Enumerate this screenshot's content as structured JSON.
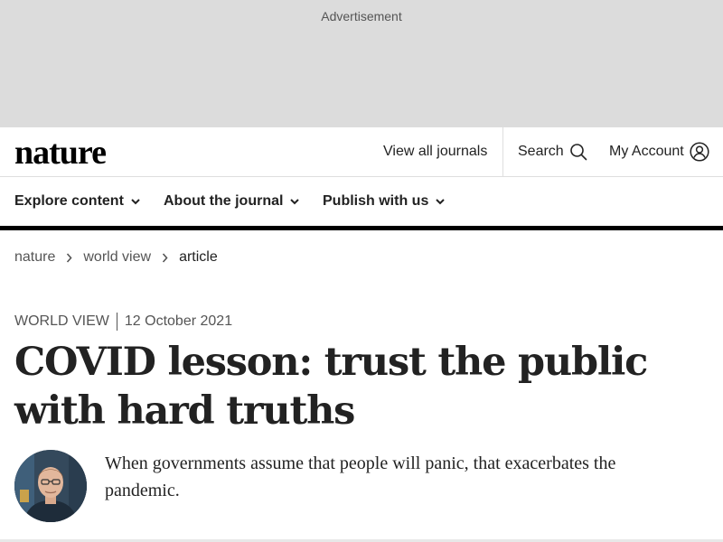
{
  "advertisement": {
    "label": "Advertisement"
  },
  "header": {
    "logo": "nature",
    "view_all_journals": "View all journals",
    "search_label": "Search",
    "account_label": "My Account"
  },
  "subnav": {
    "items": [
      {
        "label": "Explore content"
      },
      {
        "label": "About the journal"
      },
      {
        "label": "Publish with us"
      }
    ]
  },
  "breadcrumb": {
    "items": [
      "nature",
      "world view",
      "article"
    ]
  },
  "article": {
    "type": "World View",
    "date": "12 October 2021",
    "title": "COVID lesson: trust the public with hard truths",
    "standfirst": "When governments assume that people will panic, that exacerbates the pandemic."
  },
  "colors": {
    "ad_background": "#dcdcdc",
    "text": "#222222",
    "muted": "#555555",
    "bar": "#000000"
  },
  "icons": {
    "search": "search-icon",
    "account": "account-icon",
    "chevron": "chevron-down-icon",
    "breadcrumb_separator": "chevron-right-icon"
  }
}
